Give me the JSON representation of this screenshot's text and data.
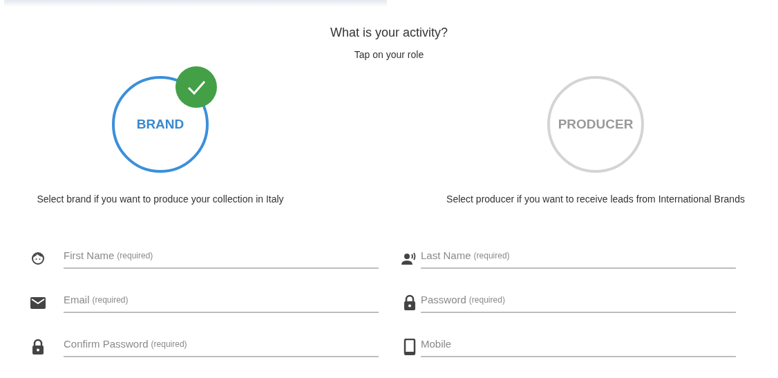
{
  "heading": "What is your activity?",
  "subheading": "Tap on your role",
  "roles": [
    {
      "label": "BRAND",
      "selected": true,
      "description": "Select brand if you want to produce your collection in Italy"
    },
    {
      "label": "PRODUCER",
      "selected": false,
      "description": "Select producer if you want to receive leads from International Brands"
    }
  ],
  "fields": [
    {
      "kind": "face",
      "label": "First Name",
      "note": "(required)"
    },
    {
      "kind": "voice",
      "label": "Last Name",
      "note": "(required)"
    },
    {
      "kind": "mail",
      "label": "Email",
      "note": "(required)"
    },
    {
      "kind": "lock",
      "label": "Password",
      "note": "(required)"
    },
    {
      "kind": "lock",
      "label": "Confirm Password",
      "note": "(required)"
    },
    {
      "kind": "phone",
      "label": "Mobile"
    }
  ]
}
